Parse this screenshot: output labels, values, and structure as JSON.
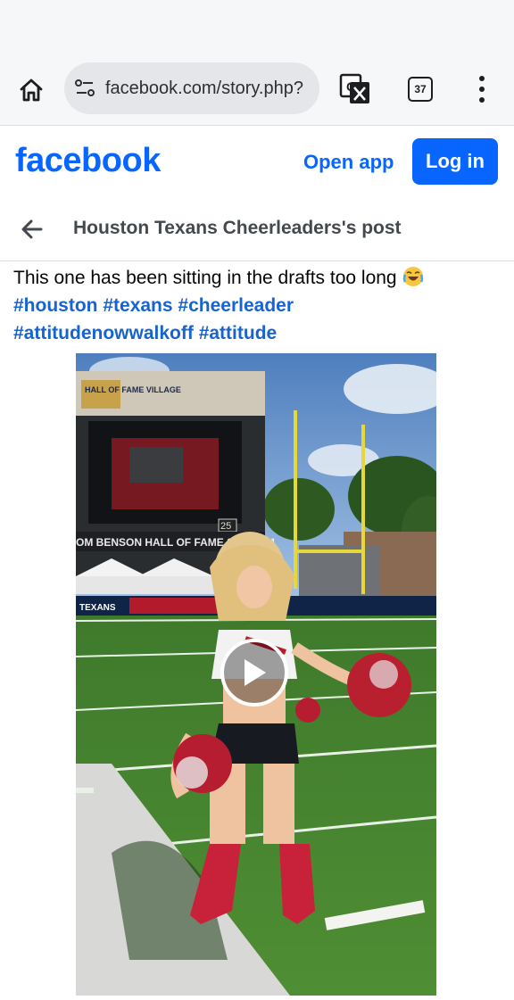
{
  "browser": {
    "url": "facebook.com/story.php?",
    "tab_count": "37"
  },
  "header": {
    "logo": "facebook",
    "open_app_label": "Open app",
    "login_label": "Log in"
  },
  "post_nav": {
    "title": "Houston Texans Cheerleaders's post"
  },
  "post": {
    "text": "This one has been sitting in the drafts too long",
    "tags": [
      "#houston",
      "#texans",
      "#cheerleader",
      "#attitudenowwalkoff",
      "#attitude"
    ],
    "video": {
      "stadium_sign": "OM BENSON HALL OF FAME STADIUM",
      "venue_logo": "HALL OF FAME VILLAGE",
      "scoreboard_number": "25",
      "banner_text": "TEXANS"
    }
  },
  "colors": {
    "brand_blue": "#0866ff",
    "hashtag_blue": "#1763cf"
  }
}
